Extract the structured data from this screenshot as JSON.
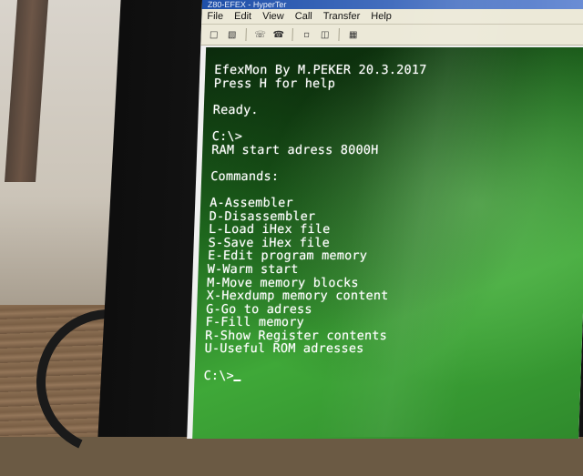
{
  "window": {
    "title": "Z80-EFEX - HyperTer"
  },
  "menubar": {
    "items": [
      "File",
      "Edit",
      "View",
      "Call",
      "Transfer",
      "Help"
    ]
  },
  "toolbar": {
    "icons": [
      "new-icon",
      "open-icon",
      "phone-icon",
      "disconnect-icon",
      "send-icon",
      "receive-icon",
      "properties-icon"
    ]
  },
  "terminal": {
    "header": "EfexMon By M.PEKER 20.3.2017",
    "help_hint": "Press H for help",
    "status": "Ready.",
    "prompt1": "C:\\>",
    "ram_info": "RAM start adress 8000H",
    "commands_heading": "Commands:",
    "commands": [
      "A-Assembler",
      "D-Disassembler",
      "L-Load iHex file",
      "S-Save iHex file",
      "E-Edit program memory",
      "W-Warm start",
      "M-Move memory blocks",
      "X-Hexdump memory content",
      "G-Go to adress",
      "F-Fill memory",
      "R-Show Register contents",
      "U-Useful ROM adresses"
    ],
    "prompt2": "C:\\>"
  },
  "colors": {
    "terminal_text": "#ffffff",
    "terminal_bg": "#2f8a2c",
    "menubar_bg": "#ece9d8",
    "titlebar": "#1e4fa8"
  }
}
